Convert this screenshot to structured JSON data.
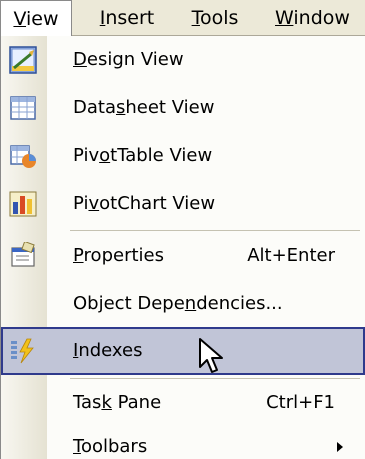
{
  "menubar": {
    "items": [
      {
        "pre": "",
        "ul": "V",
        "post": "iew"
      },
      {
        "pre": "",
        "ul": "I",
        "post": "nsert"
      },
      {
        "pre": "",
        "ul": "T",
        "post": "ools"
      },
      {
        "pre": "",
        "ul": "W",
        "post": "indow"
      }
    ]
  },
  "menu": {
    "items": [
      {
        "icon": "design-view-icon",
        "pre": "",
        "ul": "D",
        "post": "esign View",
        "shortcut": ""
      },
      {
        "icon": "datasheet-view-icon",
        "pre": "Data",
        "ul": "s",
        "post": "heet View",
        "shortcut": ""
      },
      {
        "icon": "pivottable-view-icon",
        "pre": "Piv",
        "ul": "o",
        "post": "tTable View",
        "shortcut": ""
      },
      {
        "icon": "pivotchart-view-icon",
        "pre": "Pi",
        "ul": "v",
        "post": "otChart View",
        "shortcut": ""
      },
      {
        "icon": "properties-icon",
        "pre": "",
        "ul": "P",
        "post": "roperties",
        "shortcut": "Alt+Enter"
      },
      {
        "icon": "",
        "pre": "Object Depe",
        "ul": "n",
        "post": "dencies...",
        "shortcut": ""
      },
      {
        "icon": "indexes-icon",
        "pre": "",
        "ul": "I",
        "post": "ndexes",
        "shortcut": ""
      },
      {
        "icon": "",
        "pre": "Tas",
        "ul": "k",
        "post": " Pane",
        "shortcut": "Ctrl+F1"
      },
      {
        "icon": "",
        "pre": "",
        "ul": "T",
        "post": "oolbars",
        "shortcut": ""
      }
    ]
  },
  "colors": {
    "highlight_bg": "#c1c5d7",
    "highlight_border": "#2f3a8c",
    "menubar_bg": "#ece9d8"
  }
}
